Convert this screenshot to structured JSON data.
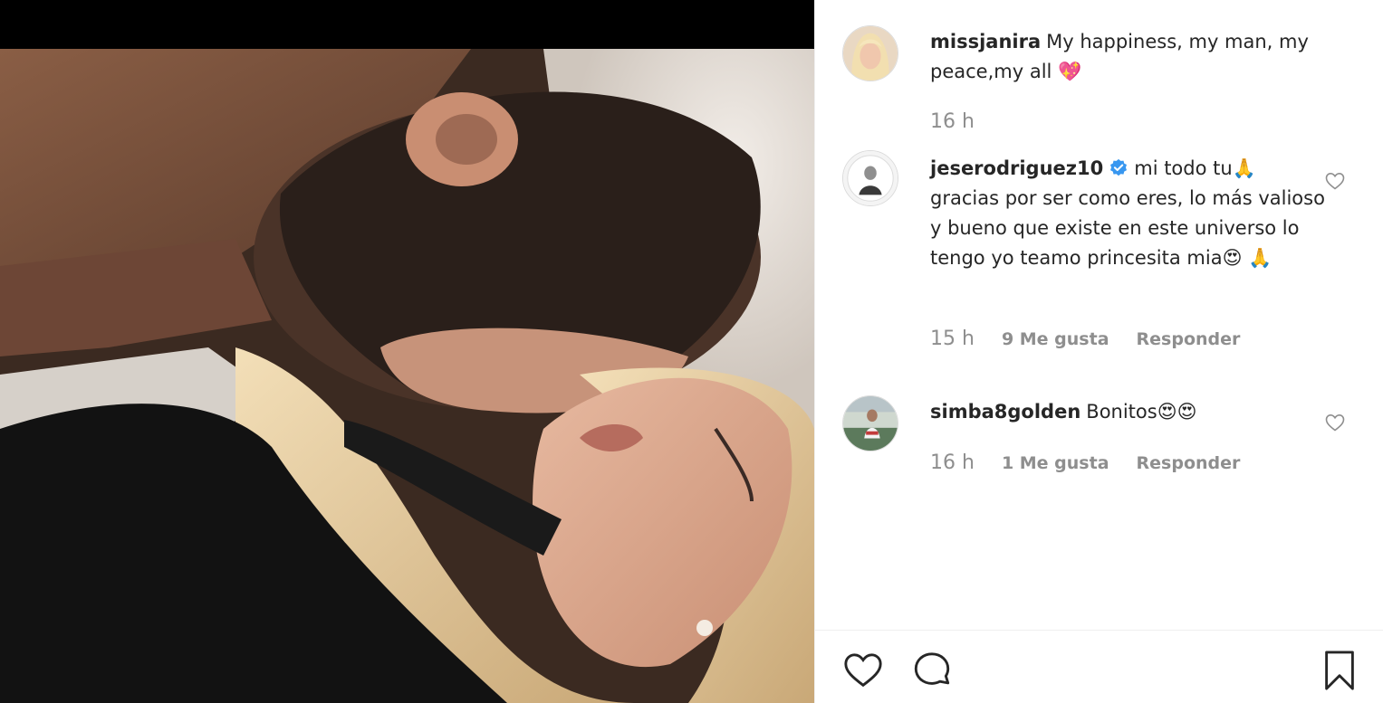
{
  "caption": {
    "username": "missjanira",
    "text": "My happiness, my man, my peace,my all",
    "emoji": "💖",
    "time": "16 h"
  },
  "comments": [
    {
      "username": "jeserodriguez10",
      "verified": true,
      "text": "mi todo tu",
      "emoji_1": "🙏",
      "text_2": "gracias por ser como eres, lo más valioso y bueno que existe en este universo lo tengo yo teamo princesita mia",
      "emoji_2": "😍 🙏",
      "time": "15 h",
      "likes": "9 Me gusta",
      "reply": "Responder"
    },
    {
      "username": "simba8golden",
      "verified": false,
      "text": "Bonitos",
      "emoji_1": "😍😍",
      "time": "16 h",
      "likes": "1 Me gusta",
      "reply": "Responder"
    }
  ],
  "icons": {
    "like": "heart-icon",
    "comment": "comment-bubble-icon",
    "save": "bookmark-icon",
    "comment_like": "heart-small-icon",
    "verified": "verified-badge-icon"
  },
  "colors": {
    "text": "#262626",
    "muted": "#8e8e8e",
    "verified": "#3897f0",
    "divider": "#efefef"
  }
}
